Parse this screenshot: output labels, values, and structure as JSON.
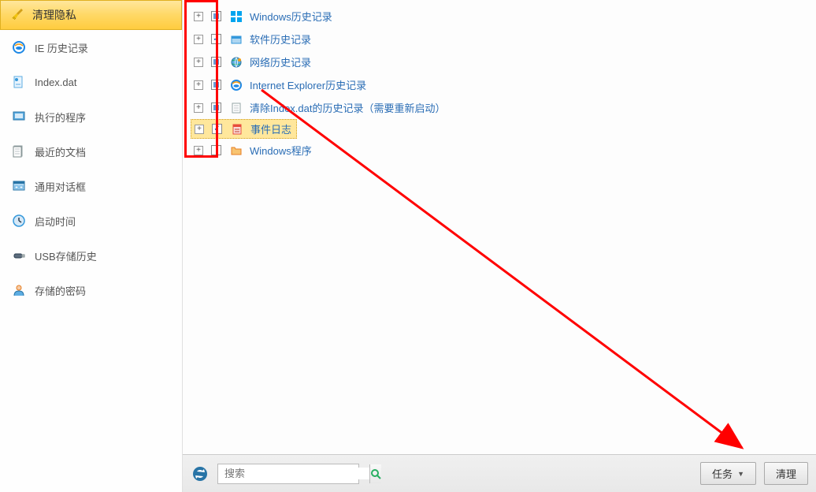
{
  "sidebar": {
    "header": {
      "label": "清理隐私",
      "icon": "broom-icon"
    },
    "items": [
      {
        "label": "IE 历史记录",
        "icon": "ie-icon"
      },
      {
        "label": "Index.dat",
        "icon": "file-icon"
      },
      {
        "label": "执行的程序",
        "icon": "run-icon"
      },
      {
        "label": "最近的文档",
        "icon": "document-icon"
      },
      {
        "label": "通用对话框",
        "icon": "dialog-icon"
      },
      {
        "label": "启动时间",
        "icon": "clock-icon"
      },
      {
        "label": "USB存储历史",
        "icon": "usb-icon"
      },
      {
        "label": "存储的密码",
        "icon": "user-icon"
      }
    ]
  },
  "tree": {
    "items": [
      {
        "label": "Windows历史记录",
        "checked": "square",
        "icon": "windows-icon",
        "icon_color": "#00a4ef"
      },
      {
        "label": "软件历史记录",
        "checked": "checked",
        "icon": "software-icon",
        "icon_color": "#3498db"
      },
      {
        "label": "网络历史记录",
        "checked": "square",
        "icon": "globe-icon",
        "icon_color": "#e67e22"
      },
      {
        "label": "Internet  Explorer历史记录",
        "checked": "square",
        "icon": "ie-icon",
        "icon_color": "#1e88e5"
      },
      {
        "label": "清除Index.dat的历史记录（需要重新启动）",
        "checked": "square",
        "icon": "page-icon",
        "icon_color": "#95a5a6"
      },
      {
        "label": "事件日志",
        "checked": "checked",
        "icon": "log-icon",
        "icon_color": "#e74c3c",
        "highlighted": true
      },
      {
        "label": "Windows程序",
        "checked": "",
        "icon": "folder-icon",
        "icon_color": "#f39c12"
      }
    ]
  },
  "bottomBar": {
    "search_placeholder": "搜索",
    "task_button": "任务",
    "clean_button": "清理"
  }
}
